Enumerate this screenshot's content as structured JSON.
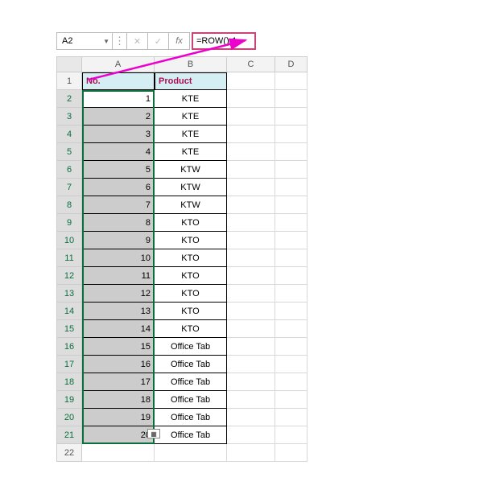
{
  "formula_bar": {
    "name_box": "A2",
    "cancel": "✕",
    "accept": "✓",
    "fx": "fx",
    "formula": "=ROW()-1"
  },
  "columns": [
    "",
    "A",
    "B",
    "C",
    "D"
  ],
  "headers": {
    "col_a": "No.",
    "col_b": "Product"
  },
  "rows": [
    {
      "r": 1
    },
    {
      "r": 2,
      "a": "1",
      "b": "KTE",
      "active": true
    },
    {
      "r": 3,
      "a": "2",
      "b": "KTE"
    },
    {
      "r": 4,
      "a": "3",
      "b": "KTE"
    },
    {
      "r": 5,
      "a": "4",
      "b": "KTE"
    },
    {
      "r": 6,
      "a": "5",
      "b": "KTW"
    },
    {
      "r": 7,
      "a": "6",
      "b": "KTW"
    },
    {
      "r": 8,
      "a": "7",
      "b": "KTW"
    },
    {
      "r": 9,
      "a": "8",
      "b": "KTO"
    },
    {
      "r": 10,
      "a": "9",
      "b": "KTO"
    },
    {
      "r": 11,
      "a": "10",
      "b": "KTO"
    },
    {
      "r": 12,
      "a": "11",
      "b": "KTO"
    },
    {
      "r": 13,
      "a": "12",
      "b": "KTO"
    },
    {
      "r": 14,
      "a": "13",
      "b": "KTO"
    },
    {
      "r": 15,
      "a": "14",
      "b": "KTO"
    },
    {
      "r": 16,
      "a": "15",
      "b": "Office Tab"
    },
    {
      "r": 17,
      "a": "16",
      "b": "Office Tab"
    },
    {
      "r": 18,
      "a": "17",
      "b": "Office Tab"
    },
    {
      "r": 19,
      "a": "18",
      "b": "Office Tab"
    },
    {
      "r": 20,
      "a": "19",
      "b": "Office Tab"
    },
    {
      "r": 21,
      "a": "20",
      "b": "Office Tab"
    },
    {
      "r": 22
    }
  ]
}
